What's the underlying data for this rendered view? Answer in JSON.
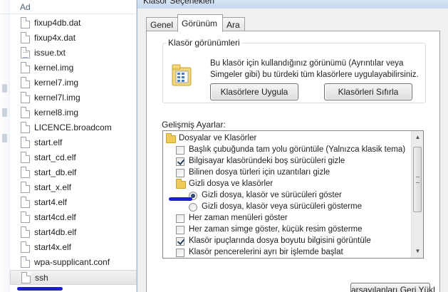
{
  "file_pane": {
    "column_header": "Ad",
    "files": [
      {
        "name": "fixup4db.dat",
        "type": "file"
      },
      {
        "name": "fixup4x.dat",
        "type": "file"
      },
      {
        "name": "issue.txt",
        "type": "text"
      },
      {
        "name": "kernel.img",
        "type": "file"
      },
      {
        "name": "kernel7.img",
        "type": "file"
      },
      {
        "name": "kernel7l.img",
        "type": "file"
      },
      {
        "name": "kernel8.img",
        "type": "file"
      },
      {
        "name": "LICENCE.broadcom",
        "type": "file"
      },
      {
        "name": "start.elf",
        "type": "file"
      },
      {
        "name": "start_cd.elf",
        "type": "file"
      },
      {
        "name": "start_db.elf",
        "type": "file"
      },
      {
        "name": "start_x.elf",
        "type": "file"
      },
      {
        "name": "start4.elf",
        "type": "file"
      },
      {
        "name": "start4cd.elf",
        "type": "file"
      },
      {
        "name": "start4db.elf",
        "type": "file"
      },
      {
        "name": "start4x.elf",
        "type": "file"
      },
      {
        "name": "wpa-supplicant.conf",
        "type": "file"
      },
      {
        "name": "ssh",
        "type": "file",
        "selected": true
      }
    ]
  },
  "dialog": {
    "title": "Klasör Seçenekleri",
    "tabs": [
      {
        "label": "Genel",
        "active": false
      },
      {
        "label": "Görünüm",
        "active": true
      },
      {
        "label": "Ara",
        "active": false
      }
    ],
    "folder_views": {
      "group_label": "Klasör görünümleri",
      "description": "Bu klasör için kullandığınız görünümü (Ayrıntılar veya Simgeler gibi) bu türdeki tüm klasörlere uygulayabilirsiniz.",
      "apply_button": "Klasörlere Uygula",
      "reset_button": "Klasörleri Sıfırla"
    },
    "advanced": {
      "label": "Gelişmiş Ayarlar:",
      "items": [
        {
          "kind": "folder",
          "level": 0,
          "text": "Dosyalar ve Klasörler"
        },
        {
          "kind": "checkbox",
          "level": 1,
          "checked": false,
          "text": "Başlık çubuğunda tam yolu görüntüle (Yalnızca klasik tema)"
        },
        {
          "kind": "checkbox",
          "level": 1,
          "checked": true,
          "text": "Bilgisayar klasöründeki boş sürücüleri gizle"
        },
        {
          "kind": "checkbox",
          "level": 1,
          "checked": false,
          "text": "Bilinen dosya türleri için uzantıları gizle"
        },
        {
          "kind": "folder",
          "level": 1,
          "text": "Gizli dosya ve klasörler"
        },
        {
          "kind": "radio",
          "level": 2,
          "checked": true,
          "text": "Gizli dosya, klasör ve sürücüleri göster"
        },
        {
          "kind": "radio",
          "level": 2,
          "checked": false,
          "text": "Gizli dosya, klasör veya sürücüleri gösterme"
        },
        {
          "kind": "checkbox",
          "level": 1,
          "checked": false,
          "text": "Her zaman menüleri göster"
        },
        {
          "kind": "checkbox",
          "level": 1,
          "checked": false,
          "text": "Her zaman simge göster, küçük resim gösterme"
        },
        {
          "kind": "checkbox",
          "level": 1,
          "checked": true,
          "text": "Klasör ipuçlarında dosya boyutu bilgisini görüntüle"
        },
        {
          "kind": "checkbox",
          "level": 1,
          "checked": false,
          "text": "Klasör pencerelerini ayrı bir işlemde başlat"
        }
      ]
    },
    "restore_defaults_button": "arsayılanları Geri Yükl"
  },
  "colors": {
    "annotation_mark": "#1d1dd6",
    "panel_border": "#a0a0a0",
    "dialog_background": "#f0f0f0"
  }
}
